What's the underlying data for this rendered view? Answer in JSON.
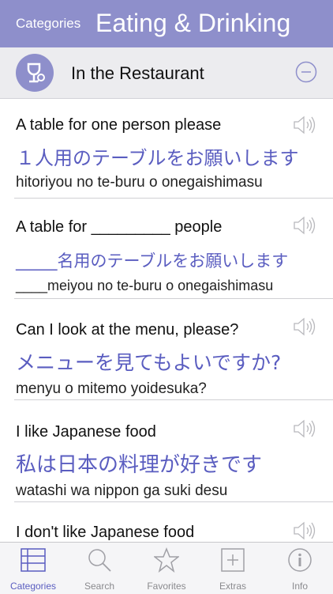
{
  "header": {
    "back_label": "Categories",
    "title": "Eating & Drinking"
  },
  "section": {
    "title": "In the Restaurant"
  },
  "entries": [
    {
      "en": "A table for one person please",
      "jp": "１人用のテーブルをお願いします",
      "ro": "hitoriyou no te-buru o onegaishimasu"
    },
    {
      "en": "A table for _________ people",
      "jp": "_____名用のテーブルをお願いします",
      "ro": "____meiyou no te-buru o onegaishimasu"
    },
    {
      "en": "Can I look at the menu, please?",
      "jp": "メニューを見てもよいですか?",
      "ro": "menyu o mitemo yoidesuka?"
    },
    {
      "en": "I like Japanese food",
      "jp": "私は日本の料理が好きです",
      "ro": "watashi wa nippon ga suki desu"
    },
    {
      "en": "I don't like Japanese food",
      "jp": "",
      "ro": ""
    }
  ],
  "tabs": [
    {
      "label": "Categories",
      "icon": "list-icon",
      "active": true
    },
    {
      "label": "Search",
      "icon": "search-icon",
      "active": false
    },
    {
      "label": "Favorites",
      "icon": "star-icon",
      "active": false
    },
    {
      "label": "Extras",
      "icon": "plus-icon",
      "active": false
    },
    {
      "label": "Info",
      "icon": "info-icon",
      "active": false
    }
  ],
  "colors": {
    "accent": "#8e8fcb",
    "japanese_text": "#5a5dc0",
    "section_bg": "#ececef"
  }
}
